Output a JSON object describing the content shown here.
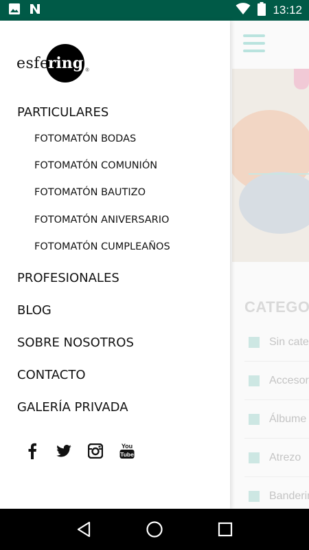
{
  "status_bar": {
    "time": "13:12",
    "icons": [
      "image-icon",
      "n-icon",
      "wifi-icon",
      "battery-icon"
    ],
    "bg_color": "#005a47"
  },
  "logo": {
    "part1": "esfe",
    "part2": "ring",
    "registered": "®"
  },
  "menu": {
    "particulares": "PARTICULARES",
    "sub_items": [
      "FOTOMATÓN BODAS",
      "FOTOMATÓN COMUNIÓN",
      "FOTOMATÓN BAUTIZO",
      "FOTOMATÓN ANIVERSARIO",
      "FOTOMATÓN CUMPLEAÑOS"
    ],
    "profesionales": "PROFESIONALES",
    "blog": "BLOG",
    "sobre_nosotros": "SOBRE NOSOTROS",
    "contacto": "CONTACTO",
    "galeria_privada": "GALERÍA PRIVADA"
  },
  "social": [
    "facebook-icon",
    "twitter-icon",
    "instagram-icon",
    "youtube-icon"
  ],
  "background_page": {
    "categories_title": "CATEGOR",
    "categories": [
      "Sin cate",
      "Accesor",
      "Álbume",
      "Atrezo",
      "Banderir"
    ],
    "accent_color": "#b9e3de"
  },
  "nav_bar": {
    "buttons": [
      "back-icon",
      "home-icon",
      "recents-icon"
    ]
  }
}
